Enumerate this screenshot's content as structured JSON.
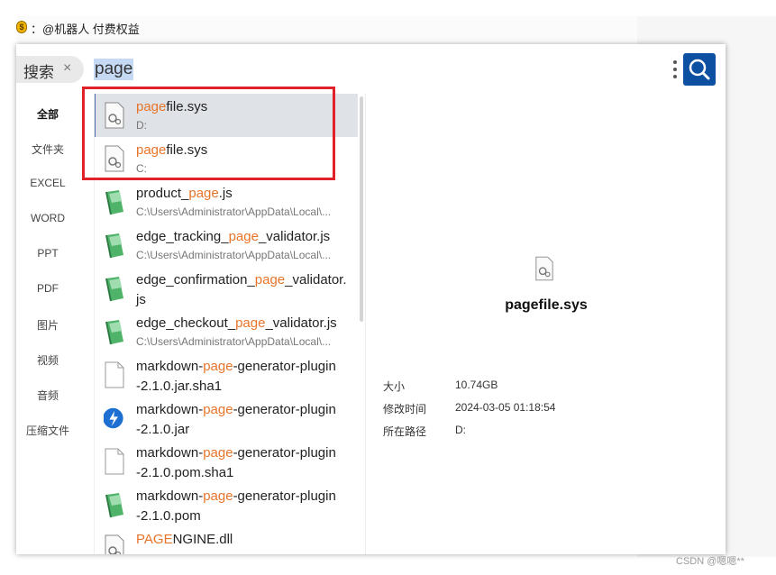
{
  "notice": {
    "coin": "$",
    "text": "：@机器人 付费权益"
  },
  "search": {
    "scope_label": "搜索",
    "close_glyph": "×",
    "query": "page"
  },
  "categories": [
    "全部",
    "文件夹",
    "EXCEL",
    "WORD",
    "PPT",
    "PDF",
    "图片",
    "视频",
    "音频",
    "压缩文件"
  ],
  "results": [
    {
      "hl": "page",
      "rest": "file.sys",
      "path": "D:",
      "icon": "system-file-icon",
      "selected": true
    },
    {
      "hl": "page",
      "rest": "file.sys",
      "path": "C:",
      "icon": "system-file-icon"
    },
    {
      "pre": "product_",
      "hl": "page",
      "rest": ".js",
      "path": "C:\\Users\\Administrator\\AppData\\Local\\...",
      "icon": "js-file-icon"
    },
    {
      "pre": "edge_tracking_",
      "hl": "page",
      "rest": "_validator.js",
      "path": "C:\\Users\\Administrator\\AppData\\Local\\...",
      "icon": "js-file-icon"
    },
    {
      "pre": "edge_confirmation_",
      "hl": "page",
      "rest": "_validator.",
      "line2": "js",
      "icon": "js-file-icon"
    },
    {
      "pre": "edge_checkout_",
      "hl": "page",
      "rest": "_validator.js",
      "path": "C:\\Users\\Administrator\\AppData\\Local\\...",
      "icon": "js-file-icon"
    },
    {
      "pre": "markdown-",
      "hl": "page",
      "rest": "-generator-plugin",
      "line2": "-2.1.0.jar.sha1",
      "icon": "blank-file-icon"
    },
    {
      "pre": "markdown-",
      "hl": "page",
      "rest": "-generator-plugin",
      "line2": "-2.1.0.jar",
      "icon": "jar-file-icon"
    },
    {
      "pre": "markdown-",
      "hl": "page",
      "rest": "-generator-plugin",
      "line2": "-2.1.0.pom.sha1",
      "icon": "blank-file-icon"
    },
    {
      "pre": "markdown-",
      "hl": "page",
      "rest": "-generator-plugin",
      "line2": "-2.1.0.pom",
      "icon": "js-file-icon"
    },
    {
      "hl": "PAGE",
      "rest": "NGINE.dll",
      "icon": "system-file-icon"
    }
  ],
  "detail": {
    "title": "pagefile.sys",
    "rows": [
      {
        "label": "大小",
        "value": "10.74GB"
      },
      {
        "label": "修改时间",
        "value": "2024-03-05 01:18:54"
      },
      {
        "label": "所在路径",
        "value": "D:"
      }
    ]
  },
  "watermark": "CSDN @嗯嗯**",
  "colors": {
    "highlight": "#e8742a",
    "search_button": "#0d4fa0",
    "callout": "#e0212a",
    "selected_row": "#dfe2e6"
  }
}
